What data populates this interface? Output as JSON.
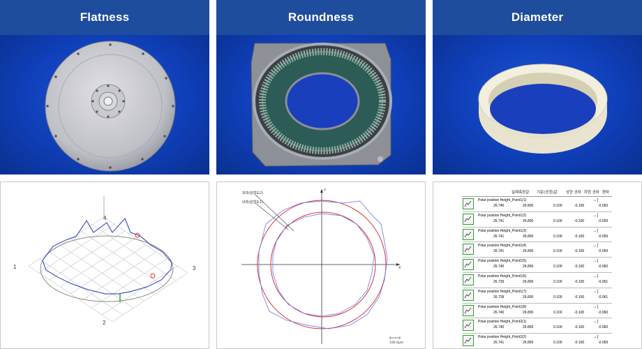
{
  "columns": [
    {
      "title": "Flatness"
    },
    {
      "title": "Roundness"
    },
    {
      "title": "Diameter"
    }
  ],
  "flatness_plot": {
    "labels": [
      "1",
      "2",
      "3",
      "4"
    ]
  },
  "roundness_plot": {
    "legend": [
      "외측(원형도2)",
      "내측(원형도1)"
    ],
    "axis_y": "Y",
    "axis_x": "X",
    "scale": "100.0μm"
  },
  "diameter_table": {
    "headers": [
      "실제측정값",
      "기준(공칭)값",
      "상한 공차",
      "하한 공차",
      "편차"
    ],
    "rows": [
      {
        "name": "Polar position Height_Point1(1)",
        "actual": "26.740",
        "nominal": "26.800",
        "upper": "0.100",
        "lower": "-0.100",
        "dev": "-0.060"
      },
      {
        "name": "Polar position Height_Point1(2)",
        "actual": "26.741",
        "nominal": "26.800",
        "upper": "0.100",
        "lower": "-0.100",
        "dev": "-0.059"
      },
      {
        "name": "Polar position Height_Point1(3)",
        "actual": "26.741",
        "nominal": "26.800",
        "upper": "0.100",
        "lower": "-0.100",
        "dev": "-0.059"
      },
      {
        "name": "Polar position Height_Point1(4)",
        "actual": "26.741",
        "nominal": "26.800",
        "upper": "0.100",
        "lower": "-0.100",
        "dev": "-0.059"
      },
      {
        "name": "Polar position Height_Point1(5)",
        "actual": "26.740",
        "nominal": "26.800",
        "upper": "0.100",
        "lower": "-0.100",
        "dev": "-0.060"
      },
      {
        "name": "Polar position Height_Point1(6)",
        "actual": "26.739",
        "nominal": "26.800",
        "upper": "0.100",
        "lower": "-0.100",
        "dev": "-0.061"
      },
      {
        "name": "Polar position Height_Point1(7)",
        "actual": "26.739",
        "nominal": "26.800",
        "upper": "0.100",
        "lower": "-0.100",
        "dev": "-0.061"
      },
      {
        "name": "Polar position Height_Point1(8)",
        "actual": "26.740",
        "nominal": "26.800",
        "upper": "0.100",
        "lower": "-0.100",
        "dev": "-0.060"
      },
      {
        "name": "Polar position Height_Point2(1)",
        "actual": "26.740",
        "nominal": "26.800",
        "upper": "0.100",
        "lower": "-0.100",
        "dev": "-0.060"
      },
      {
        "name": "Polar position Height_Point2(2)",
        "actual": "26.741",
        "nominal": "26.800",
        "upper": "0.100",
        "lower": "-0.100",
        "dev": "-0.059"
      }
    ]
  }
}
